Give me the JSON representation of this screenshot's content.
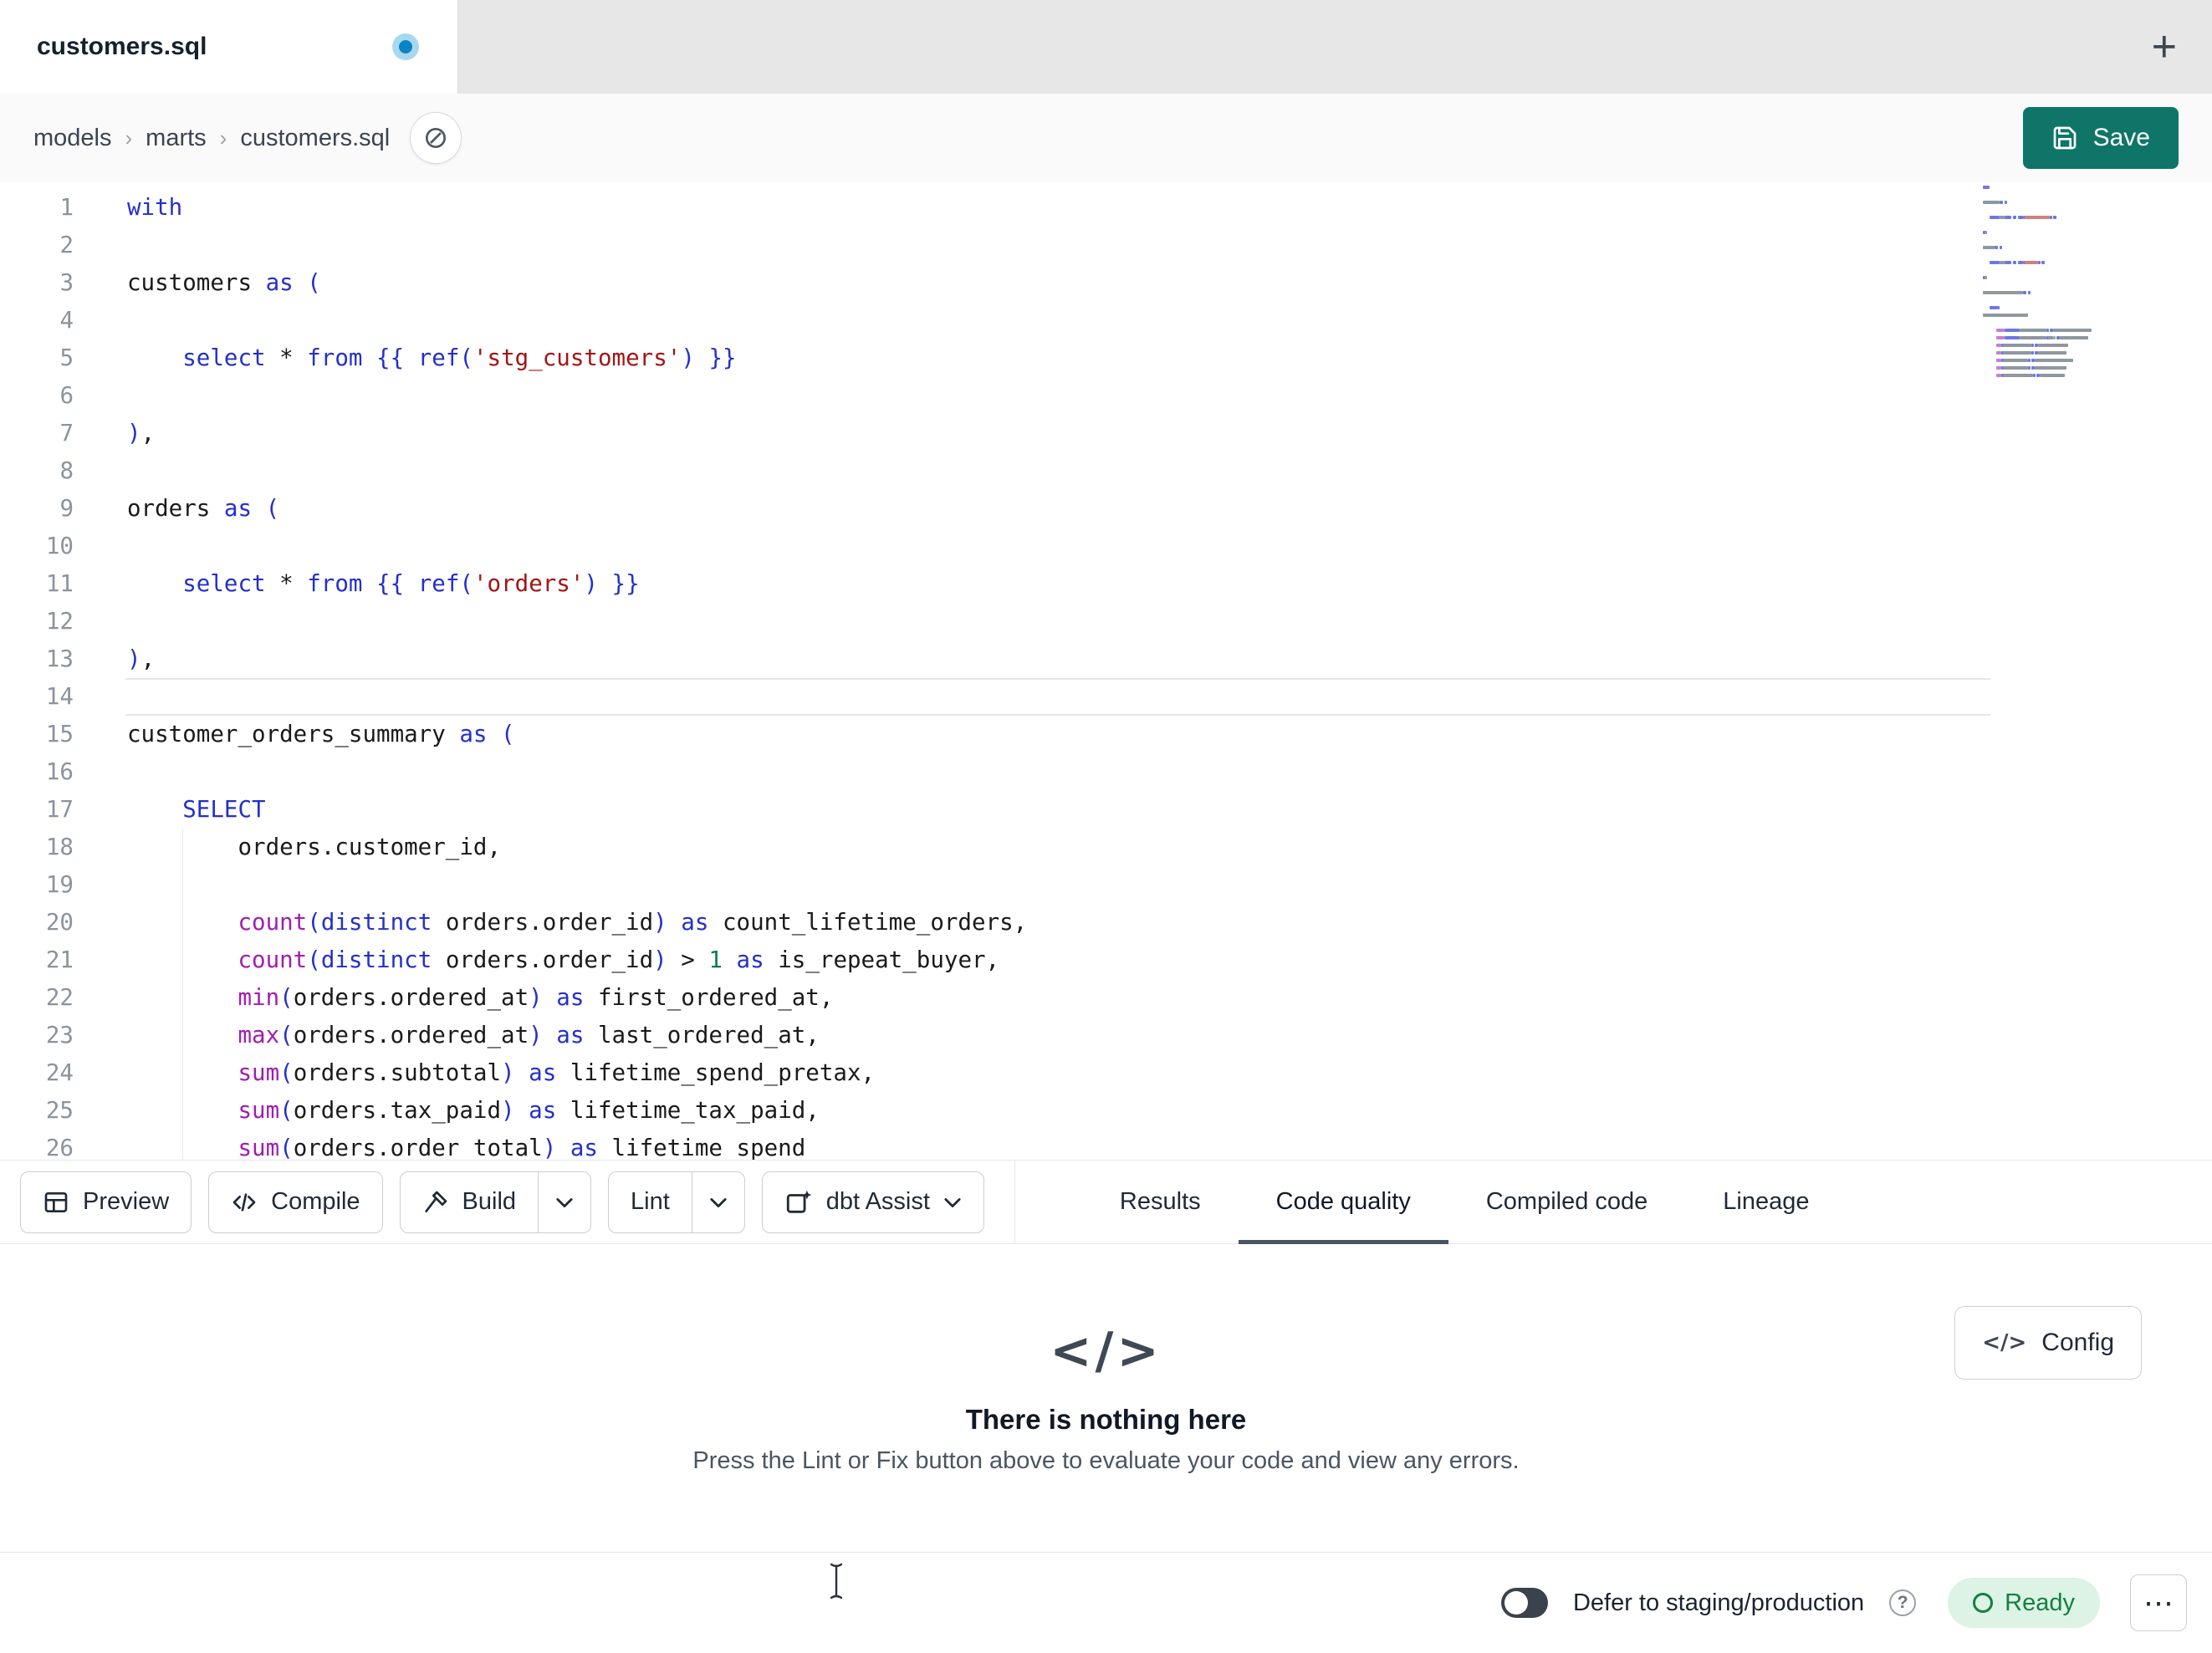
{
  "tab_bar": {
    "active_tab": {
      "label": "customers.sql",
      "modified": true
    },
    "new_tab_label": "+"
  },
  "breadcrumb": {
    "items": [
      "models",
      "marts",
      "customers.sql"
    ],
    "separator": "›"
  },
  "save_button": {
    "label": "Save"
  },
  "editor": {
    "active_line": 14,
    "lines": [
      {
        "n": 1,
        "t": [
          [
            "kw",
            "with"
          ]
        ]
      },
      {
        "n": 2,
        "t": []
      },
      {
        "n": 3,
        "t": [
          [
            "id",
            "customers "
          ],
          [
            "kw",
            "as"
          ],
          [
            "id",
            " "
          ],
          [
            "br",
            "("
          ]
        ]
      },
      {
        "n": 4,
        "t": []
      },
      {
        "n": 5,
        "t": [
          [
            "id",
            "    "
          ],
          [
            "kw",
            "select"
          ],
          [
            "id",
            " * "
          ],
          [
            "kw",
            "from"
          ],
          [
            "id",
            " "
          ],
          [
            "br",
            "{{"
          ],
          [
            "id",
            " "
          ],
          [
            "kw",
            "ref"
          ],
          [
            "br",
            "("
          ],
          [
            "str",
            "'stg_customers'"
          ],
          [
            "br",
            ")"
          ],
          [
            "id",
            " "
          ],
          [
            "br",
            "}}"
          ]
        ]
      },
      {
        "n": 6,
        "t": []
      },
      {
        "n": 7,
        "t": [
          [
            "br",
            ")"
          ],
          [
            "id",
            ","
          ]
        ]
      },
      {
        "n": 8,
        "t": []
      },
      {
        "n": 9,
        "t": [
          [
            "id",
            "orders "
          ],
          [
            "kw",
            "as"
          ],
          [
            "id",
            " "
          ],
          [
            "br",
            "("
          ]
        ]
      },
      {
        "n": 10,
        "t": []
      },
      {
        "n": 11,
        "t": [
          [
            "id",
            "    "
          ],
          [
            "kw",
            "select"
          ],
          [
            "id",
            " * "
          ],
          [
            "kw",
            "from"
          ],
          [
            "id",
            " "
          ],
          [
            "br",
            "{{"
          ],
          [
            "id",
            " "
          ],
          [
            "kw",
            "ref"
          ],
          [
            "br",
            "("
          ],
          [
            "str",
            "'orders'"
          ],
          [
            "br",
            ")"
          ],
          [
            "id",
            " "
          ],
          [
            "br",
            "}}"
          ]
        ]
      },
      {
        "n": 12,
        "t": []
      },
      {
        "n": 13,
        "t": [
          [
            "br",
            ")"
          ],
          [
            "id",
            ","
          ]
        ]
      },
      {
        "n": 14,
        "t": []
      },
      {
        "n": 15,
        "t": [
          [
            "id",
            "customer_orders_summary "
          ],
          [
            "kw",
            "as"
          ],
          [
            "id",
            " "
          ],
          [
            "br",
            "("
          ]
        ]
      },
      {
        "n": 16,
        "t": []
      },
      {
        "n": 17,
        "t": [
          [
            "id",
            "    "
          ],
          [
            "kw",
            "SELECT"
          ]
        ]
      },
      {
        "n": 18,
        "t": [
          [
            "id",
            "        orders.customer_id,"
          ]
        ]
      },
      {
        "n": 19,
        "t": []
      },
      {
        "n": 20,
        "t": [
          [
            "id",
            "        "
          ],
          [
            "fn",
            "count"
          ],
          [
            "br",
            "("
          ],
          [
            "kw",
            "distinct"
          ],
          [
            "id",
            " orders.order_id"
          ],
          [
            "br",
            ")"
          ],
          [
            "id",
            " "
          ],
          [
            "kw",
            "as"
          ],
          [
            "id",
            " count_lifetime_orders,"
          ]
        ]
      },
      {
        "n": 21,
        "t": [
          [
            "id",
            "        "
          ],
          [
            "fn",
            "count"
          ],
          [
            "br",
            "("
          ],
          [
            "kw",
            "distinct"
          ],
          [
            "id",
            " orders.order_id"
          ],
          [
            "br",
            ")"
          ],
          [
            "id",
            " > "
          ],
          [
            "num",
            "1"
          ],
          [
            "id",
            " "
          ],
          [
            "kw",
            "as"
          ],
          [
            "id",
            " is_repeat_buyer,"
          ]
        ]
      },
      {
        "n": 22,
        "t": [
          [
            "id",
            "        "
          ],
          [
            "fn",
            "min"
          ],
          [
            "br",
            "("
          ],
          [
            "id",
            "orders.ordered_at"
          ],
          [
            "br",
            ")"
          ],
          [
            "id",
            " "
          ],
          [
            "kw",
            "as"
          ],
          [
            "id",
            " first_ordered_at,"
          ]
        ]
      },
      {
        "n": 23,
        "t": [
          [
            "id",
            "        "
          ],
          [
            "fn",
            "max"
          ],
          [
            "br",
            "("
          ],
          [
            "id",
            "orders.ordered_at"
          ],
          [
            "br",
            ")"
          ],
          [
            "id",
            " "
          ],
          [
            "kw",
            "as"
          ],
          [
            "id",
            " last_ordered_at,"
          ]
        ]
      },
      {
        "n": 24,
        "t": [
          [
            "id",
            "        "
          ],
          [
            "fn",
            "sum"
          ],
          [
            "br",
            "("
          ],
          [
            "id",
            "orders.subtotal"
          ],
          [
            "br",
            ")"
          ],
          [
            "id",
            " "
          ],
          [
            "kw",
            "as"
          ],
          [
            "id",
            " lifetime_spend_pretax,"
          ]
        ]
      },
      {
        "n": 25,
        "t": [
          [
            "id",
            "        "
          ],
          [
            "fn",
            "sum"
          ],
          [
            "br",
            "("
          ],
          [
            "id",
            "orders.tax_paid"
          ],
          [
            "br",
            ")"
          ],
          [
            "id",
            " "
          ],
          [
            "kw",
            "as"
          ],
          [
            "id",
            " lifetime_tax_paid,"
          ]
        ]
      },
      {
        "n": 26,
        "t": [
          [
            "id",
            "        "
          ],
          [
            "fn",
            "sum"
          ],
          [
            "br",
            "("
          ],
          [
            "id",
            "orders.order_total"
          ],
          [
            "br",
            ")"
          ],
          [
            "id",
            " "
          ],
          [
            "kw",
            "as"
          ],
          [
            "id",
            " lifetime_spend"
          ]
        ]
      }
    ]
  },
  "toolbar": {
    "buttons": [
      {
        "label": "Preview"
      },
      {
        "label": "Compile"
      },
      {
        "label": "Build"
      },
      {
        "label": "Lint"
      },
      {
        "label": "dbt Assist"
      }
    ],
    "tabs": [
      {
        "label": "Results",
        "active": false
      },
      {
        "label": "Code quality",
        "active": true
      },
      {
        "label": "Compiled code",
        "active": false
      },
      {
        "label": "Lineage",
        "active": false
      }
    ]
  },
  "empty_state": {
    "icon": "</>",
    "title": "There is nothing here",
    "subtitle": "Press the Lint or Fix button above to evaluate your code and view any errors."
  },
  "config_button": {
    "icon": "</>",
    "label": "Config"
  },
  "status_bar": {
    "defer_label": "Defer to staging/production",
    "help_icon": "?",
    "ready_label": "Ready",
    "menu_icon": "⋯"
  },
  "colors": {
    "accent_teal": "#0F7569",
    "keyword": "#2430C9",
    "bracket": "#2430C9",
    "string": "#A31515",
    "function": "#A21CAF",
    "number": "#0F7B4F",
    "ready_bg": "#DCF3E6",
    "ready_text": "#15803D",
    "tab_modified_dot": "#0A84C4"
  }
}
